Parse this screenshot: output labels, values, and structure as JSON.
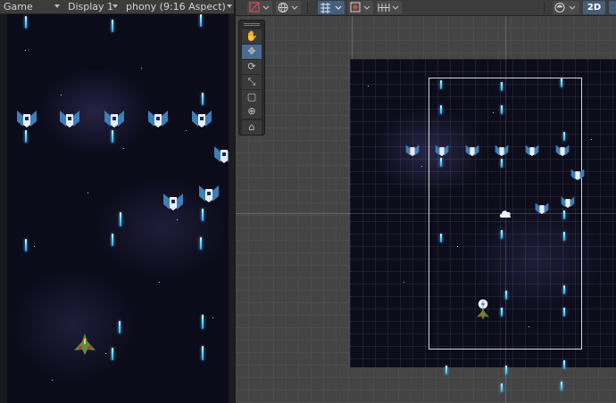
{
  "game_view": {
    "tab_label": "Game",
    "display_label": "Display 1",
    "aspect_label": "phony (9:16 Aspect)"
  },
  "scene_view": {
    "toolbar": {
      "draw_mode_icon": "shaded-icon",
      "render_icon": "globe-icon",
      "move_snap_icon": "grid-snap-icon",
      "gizmo_icon": "gizmo-icon",
      "layout_icon": "grid-layout-icon",
      "camera_icon": "scene-camera-icon",
      "mode_2d_label": "2D"
    },
    "tools": [
      {
        "name": "hand-tool",
        "icon": "hand-icon",
        "glyph": "✋"
      },
      {
        "name": "move-tool",
        "icon": "move-arrows-icon",
        "glyph": "✥"
      },
      {
        "name": "rotate-tool",
        "icon": "rotate-icon",
        "glyph": "⟳"
      },
      {
        "name": "scale-tool",
        "icon": "scale-icon",
        "glyph": "⤡"
      },
      {
        "name": "rect-tool",
        "icon": "rect-transform-icon",
        "glyph": "▢"
      },
      {
        "name": "transform-tool",
        "icon": "transform-icon",
        "glyph": "⊕"
      },
      {
        "name": "custom-tool",
        "icon": "custom-tool-icon",
        "glyph": "⌂"
      }
    ],
    "selected_tool": "move-tool"
  },
  "colors": {
    "accent_blue": "#46607c",
    "bullet": "#4cc8ff",
    "enemy_wing": "#3d7fb8",
    "player_ship": "#5e8a3a"
  }
}
